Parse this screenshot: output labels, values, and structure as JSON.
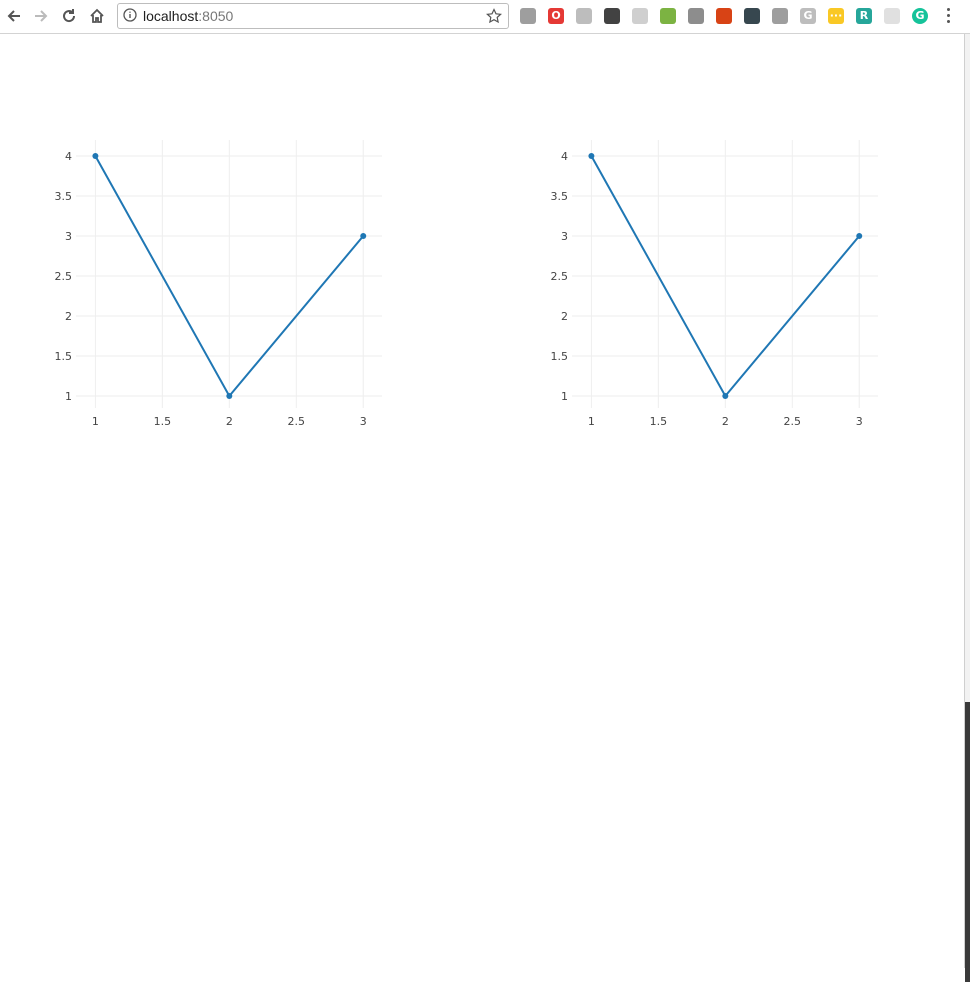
{
  "browser": {
    "url_host": "localhost",
    "url_port": ":8050",
    "icons": [
      "back-arrow-icon",
      "forward-arrow-icon",
      "reload-icon",
      "home-icon",
      "info-icon",
      "bookmark-star-icon",
      "menu-icon"
    ],
    "extensions": [
      {
        "name": "ext-q-icon",
        "color": "#9e9e9e",
        "glyph": ""
      },
      {
        "name": "ext-opera-icon",
        "color": "#e53935",
        "glyph": "O"
      },
      {
        "name": "ext-screen-icon",
        "color": "#bdbdbd",
        "glyph": ""
      },
      {
        "name": "ext-evernote-icon",
        "color": "#424242",
        "glyph": ""
      },
      {
        "name": "ext-feather-icon",
        "color": "#cfcfcf",
        "glyph": ""
      },
      {
        "name": "ext-plant-icon",
        "color": "#7cb342",
        "glyph": ""
      },
      {
        "name": "ext-camera-icon",
        "color": "#8d8d8d",
        "glyph": ""
      },
      {
        "name": "ext-book-icon",
        "color": "#d84315",
        "glyph": ""
      },
      {
        "name": "ext-wallet-icon",
        "color": "#37474f",
        "glyph": ""
      },
      {
        "name": "ext-robot-icon",
        "color": "#9e9e9e",
        "glyph": ""
      },
      {
        "name": "ext-g-icon",
        "color": "#bdbdbd",
        "glyph": "G"
      },
      {
        "name": "ext-dots-icon",
        "color": "#f9c825",
        "glyph": "···"
      },
      {
        "name": "ext-r-icon",
        "color": "#26a69a",
        "glyph": "R"
      },
      {
        "name": "ext-plug-icon",
        "color": "#e0e0e0",
        "glyph": ""
      },
      {
        "name": "ext-grammarly-icon",
        "color": "#15c39a",
        "glyph": "G"
      }
    ]
  },
  "chart_data": [
    {
      "type": "line",
      "x": [
        1,
        2,
        3
      ],
      "y": [
        4,
        1,
        3
      ],
      "xlim": [
        0.9,
        3.14
      ],
      "ylim": [
        0.8,
        4.2
      ],
      "xticks": [
        1,
        1.5,
        2,
        2.5,
        3
      ],
      "xtick_labels": [
        "1",
        "1.5",
        "2",
        "2.5",
        "3"
      ],
      "yticks": [
        1,
        1.5,
        2,
        2.5,
        3,
        3.5,
        4
      ],
      "ytick_labels": [
        "1",
        "1.5",
        "2",
        "2.5",
        "3",
        "3.5",
        "4"
      ],
      "line_color": "#1f77b4",
      "grid": true,
      "markers": true
    },
    {
      "type": "line",
      "x": [
        1,
        2,
        3
      ],
      "y": [
        4,
        1,
        3
      ],
      "xlim": [
        0.9,
        3.14
      ],
      "ylim": [
        0.8,
        4.2
      ],
      "xticks": [
        1,
        1.5,
        2,
        2.5,
        3
      ],
      "xtick_labels": [
        "1",
        "1.5",
        "2",
        "2.5",
        "3"
      ],
      "yticks": [
        1,
        1.5,
        2,
        2.5,
        3,
        3.5,
        4
      ],
      "ytick_labels": [
        "1",
        "1.5",
        "2",
        "2.5",
        "3",
        "3.5",
        "4"
      ],
      "line_color": "#1f77b4",
      "grid": true,
      "markers": true
    }
  ]
}
